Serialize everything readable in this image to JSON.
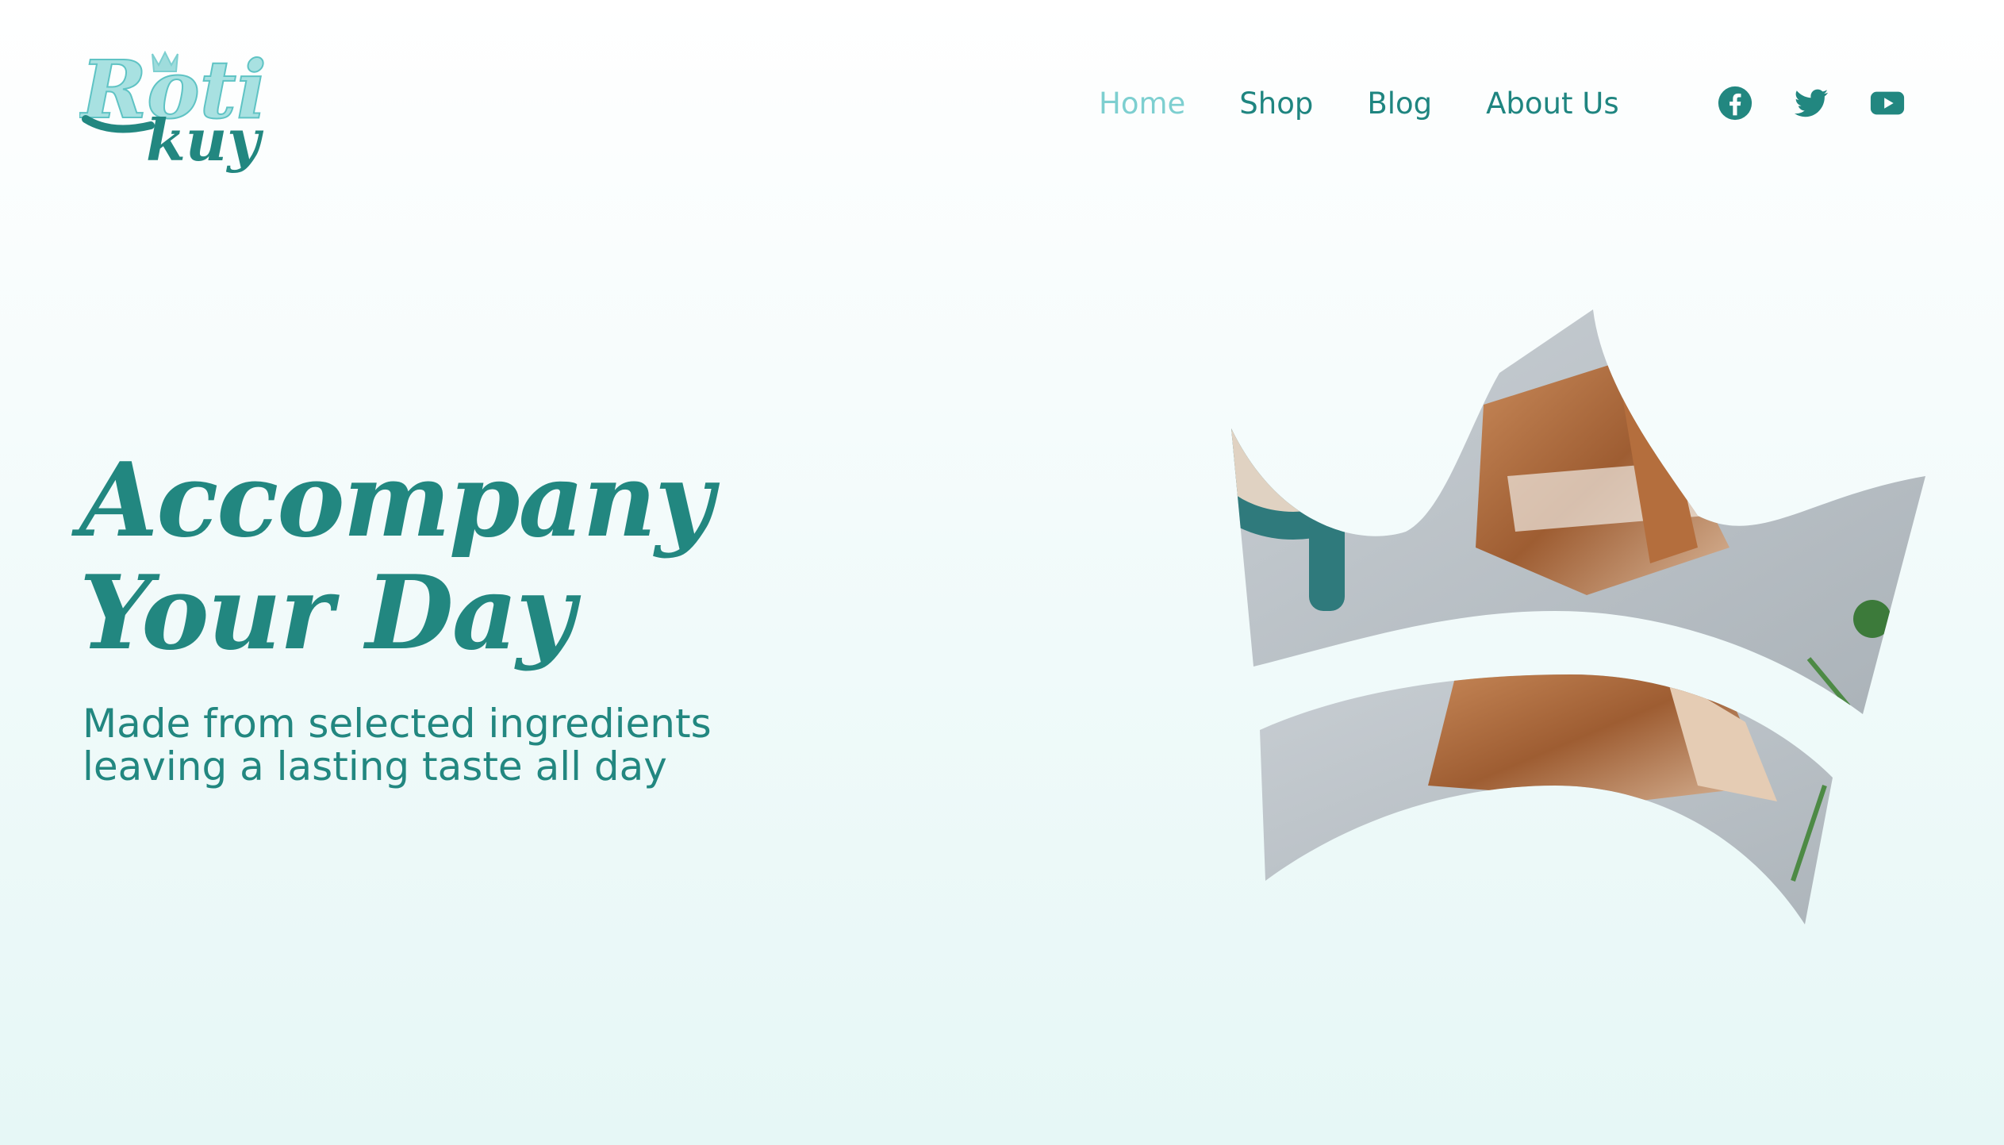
{
  "brand": {
    "logo_top": "Roti",
    "logo_bottom": "kuy",
    "colors": {
      "primary": "#228780",
      "accent": "#7dcfd0"
    }
  },
  "nav": {
    "items": [
      {
        "label": "Home",
        "active": true
      },
      {
        "label": "Shop",
        "active": false
      },
      {
        "label": "Blog",
        "active": false
      },
      {
        "label": "About Us",
        "active": false
      }
    ]
  },
  "social": [
    {
      "icon": "facebook-icon"
    },
    {
      "icon": "twitter-icon"
    },
    {
      "icon": "youtube-icon"
    }
  ],
  "hero": {
    "headline_line1": "Accompany",
    "headline_line2": "Your Day",
    "subtitle_line1": "Made from selected ingredients",
    "subtitle_line2": "leaving a lasting taste all day"
  }
}
